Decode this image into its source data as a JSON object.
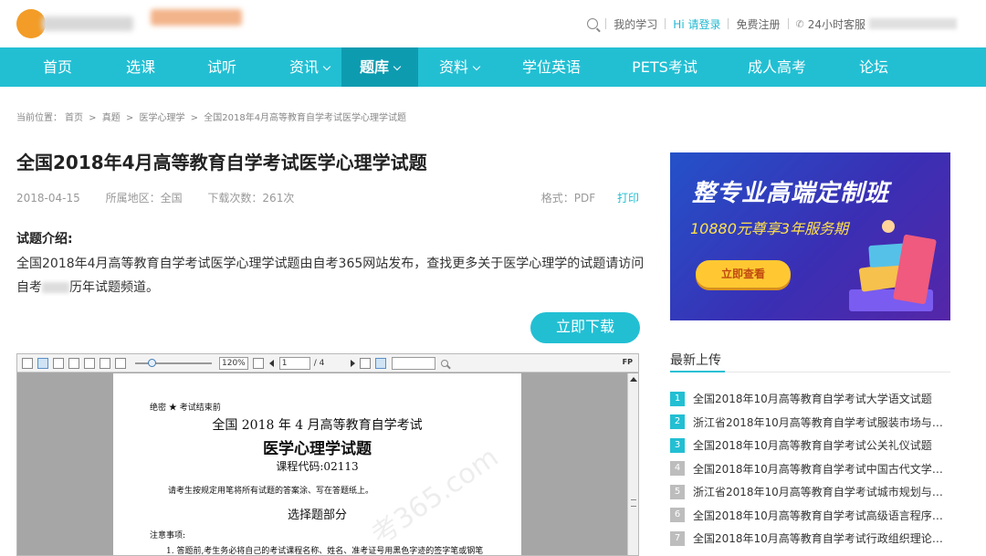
{
  "header": {
    "links": {
      "my_study": "我的学习",
      "hi_login": "Hi 请登录",
      "register": "免费注册",
      "service": "24小时客服"
    }
  },
  "nav": {
    "items": [
      "首页",
      "选课",
      "试听",
      "资讯",
      "题库",
      "资料",
      "学位英语",
      "PETS考试",
      "成人高考",
      "论坛"
    ]
  },
  "breadcrumb": {
    "label": "当前位置：",
    "items": [
      "首页",
      "真题",
      "医学心理学",
      "全国2018年4月高等教育自学考试医学心理学试题"
    ]
  },
  "article": {
    "title": "全国2018年4月高等教育自学考试医学心理学试题",
    "date": "2018-04-15",
    "region": "所属地区：全国",
    "downloads": "下载次数：261次",
    "format": "格式：PDF",
    "print": "打印",
    "intro_head": "试题介绍:",
    "intro_a": "全国2018年4月高等教育自学考试医学心理学试题由自考365网站发布，查找更多关于医学心理学的试题请访问自考",
    "intro_b": "历年试题频道。",
    "download_btn": "立即下载"
  },
  "viewer": {
    "zoom": "120%",
    "page": "1",
    "total": "/ 4",
    "fp": "FP",
    "doc": {
      "secret": "绝密 ★ 考试结束前",
      "line1": "全国 2018 年 4 月高等教育自学考试",
      "line2": "医学心理学试题",
      "line3": "课程代码:02113",
      "line4": "请考生按规定用笔将所有试题的答案涂、写在答题纸上。",
      "line5": "选择题部分",
      "line6": "注意事项:",
      "line7": "1. 答题前,考生务必将自己的考试课程名称、姓名、准考证号用黑色字迹的签字笔或钢笔",
      "watermark": "考365.com"
    }
  },
  "sidebar": {
    "banner": {
      "title": "整专业高端定制班",
      "sub": "10880元尊享3年服务期",
      "btn": "立即查看"
    },
    "recent_head": "最新上传",
    "list": [
      "全国2018年10月高等教育自学考试大学语文试题",
      "浙江省2018年10月高等教育自学考试服装市场与营...",
      "全国2018年10月高等教育自学考试公关礼仪试题",
      "全国2018年10月高等教育自学考试中国古代文学史...",
      "浙江省2018年10月高等教育自学考试城市规划与管...",
      "全国2018年10月高等教育自学考试高级语言程序设...",
      "全国2018年10月高等教育自学考试行政组织理论试题"
    ]
  }
}
